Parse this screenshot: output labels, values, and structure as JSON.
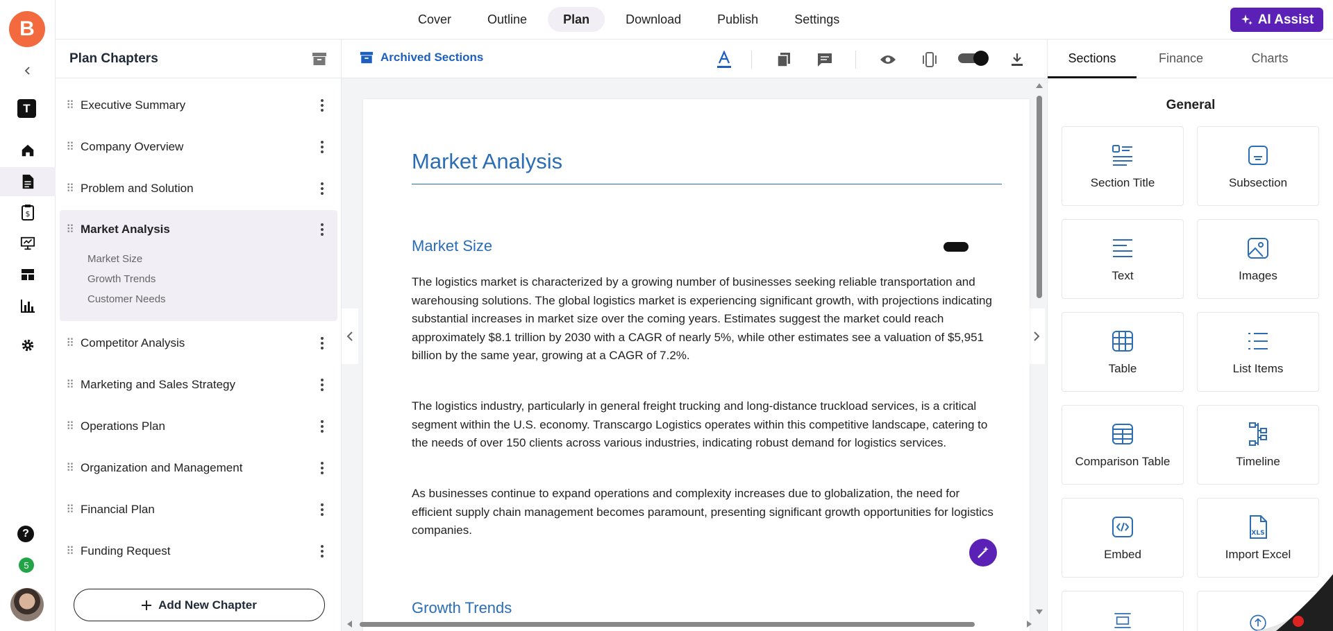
{
  "brand": {
    "logo_letter": "B",
    "workspace_letter": "T",
    "notification_count": "5",
    "help_symbol": "?"
  },
  "topnav": {
    "tabs": [
      "Cover",
      "Outline",
      "Plan",
      "Download",
      "Publish",
      "Settings"
    ],
    "active_tab": "Plan",
    "ai_assist_label": "AI Assist"
  },
  "chapters": {
    "title": "Plan Chapters",
    "items": [
      "Executive Summary",
      "Company Overview",
      "Problem and Solution",
      "Market Analysis",
      "Competitor Analysis",
      "Marketing and Sales Strategy",
      "Operations Plan",
      "Organization and Management",
      "Financial Plan",
      "Funding Request"
    ],
    "active": "Market Analysis",
    "active_subsections": [
      "Market Size",
      "Growth Trends",
      "Customer Needs"
    ],
    "add_label": "Add New Chapter"
  },
  "toolbar": {
    "archived_label": "Archived Sections"
  },
  "document": {
    "heading": "Market Analysis",
    "section1_title": "Market Size",
    "paragraphs": [
      "The logistics market is characterized by a growing number of businesses seeking reliable transportation and warehousing solutions. The global logistics market is experiencing significant growth, with projections indicating substantial increases in market size over the coming years. Estimates suggest the market could reach approximately $8.1 trillion by 2030 with a CAGR of nearly 5%, while other estimates see a valuation of $5,951 billion by the same year, growing at a CAGR of 7.2%.",
      "The logistics industry, particularly in general freight trucking and long-distance truckload services, is a critical segment within the U.S. economy. Transcargo Logistics operates within this competitive landscape, catering to the needs of over 150 clients across various industries, indicating robust demand for logistics services.",
      "As businesses continue to expand operations and complexity increases due to globalization, the need for efficient supply chain management becomes paramount, presenting significant growth opportunities for logistics companies."
    ],
    "section2_title": "Growth Trends"
  },
  "right_panel": {
    "tabs": [
      "Sections",
      "Finance",
      "Charts"
    ],
    "active_tab": "Sections",
    "section_title": "General",
    "tiles": [
      "Section Title",
      "Subsection",
      "Text",
      "Images",
      "Table",
      "List Items",
      "Comparison Table",
      "Timeline",
      "Embed",
      "Import Excel"
    ]
  },
  "colors": {
    "accent": "#5b21b6",
    "link": "#1d5fbf",
    "heading": "#2a6db5",
    "logo": "#f26a3d"
  }
}
